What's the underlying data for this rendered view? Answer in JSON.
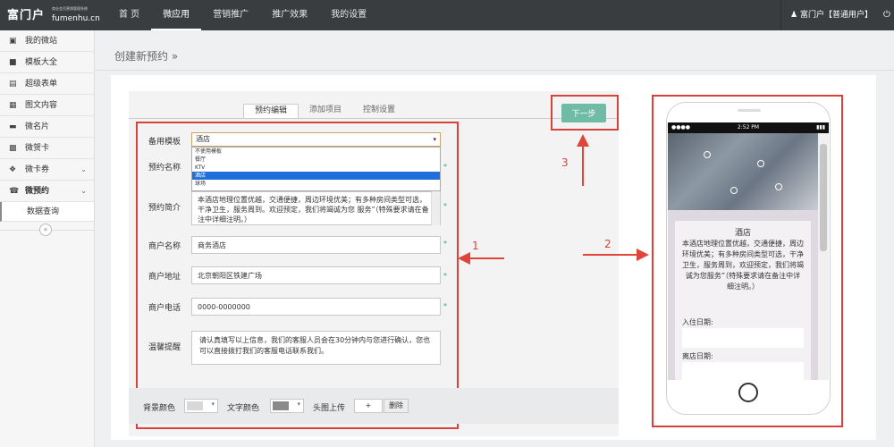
{
  "header": {
    "logo": "富门户",
    "logo_tagline": "商业会员营销管理系统",
    "logo_domain": "fumenhu.cn",
    "nav": [
      "首 页",
      "微应用",
      "营销推广",
      "推广效果",
      "我的设置"
    ],
    "active_nav": 1,
    "user": "富门户【普通用户】"
  },
  "sidebar": {
    "items": [
      {
        "label": "我的微站",
        "icon": "monitor-icon"
      },
      {
        "label": "模板大全",
        "icon": "folder-icon"
      },
      {
        "label": "超级表单",
        "icon": "form-icon"
      },
      {
        "label": "图文内容",
        "icon": "image-text-icon"
      },
      {
        "label": "微名片",
        "icon": "card-icon"
      },
      {
        "label": "微贺卡",
        "icon": "printer-icon"
      },
      {
        "label": "微卡券",
        "icon": "gift-icon"
      },
      {
        "label": "微预约",
        "icon": "phone-icon"
      }
    ],
    "sub_item": "数据查询"
  },
  "page": {
    "title": "创建新预约 »"
  },
  "tabs": [
    "预约编辑",
    "添加项目",
    "控制设置"
  ],
  "next_button": "下一步",
  "form": {
    "template_label": "备用模板",
    "template_value": "酒店",
    "template_options": [
      "不使用模板",
      "餐厅",
      "KTV",
      "酒店",
      "球场"
    ],
    "name_label": "预约名称",
    "intro_label": "预约简介",
    "intro_value": "本酒店地理位置优越，交通便捷，周边环境优美；有多种房间类型可选，干净卫生，服务周到。欢迎预定，我们将竭诚为您 服务”（特殊要求请在备注中详细注明。）",
    "shop_name_label": "商户名称",
    "shop_name_value": "商务酒店",
    "shop_addr_label": "商户地址",
    "shop_addr_value": "北京朝阳区铁建广场",
    "shop_phone_label": "商户电话",
    "shop_phone_value": "0000-0000000",
    "warm_label": "温馨提醒",
    "warm_value": "请认真填写以上信息，我们的客服人员会在30分钟内与您进行确认，您也可以直接拨打我们的客服电话联系我们。",
    "bg_color_label": "背景颜色",
    "text_color_label": "文字颜色",
    "header_upload_label": "头图上传",
    "upload_btn": "+",
    "delete_btn": "删除"
  },
  "annotations": [
    "1",
    "2",
    "3"
  ],
  "phone": {
    "status_time": "2:52 PM",
    "card_title": "酒店",
    "card_text": "本酒店地理位置优越，交通便捷，周边环境优美；有多种房间类型可选，干净卫生，服务周到，欢迎预定，我们将竭诚为您服务”（特殊要求请在备注中详细注明。）",
    "checkin_label": "入住日期:",
    "checkout_label": "离店日期:"
  },
  "colors": {
    "accent": "#6fbba6",
    "annotation": "#d9413b",
    "topbar": "#393d40"
  }
}
